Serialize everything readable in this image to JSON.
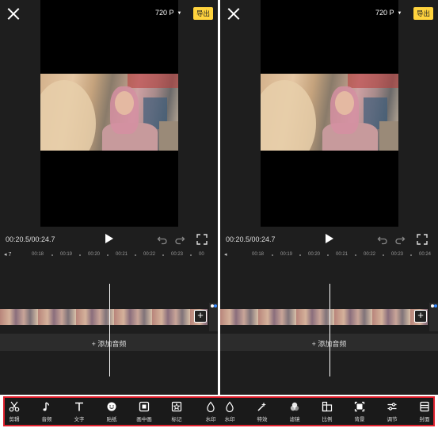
{
  "panes": [
    {
      "resolution": "720 P",
      "export_label": "导出",
      "time": "00:20.5/00:24.7",
      "ruler_start": "7",
      "ticks": [
        "00:18",
        "00:19",
        "00:20",
        "00:21",
        "00:22",
        "00:23",
        "00"
      ],
      "add_audio_label": "+ 添加音频"
    },
    {
      "resolution": "720 P",
      "export_label": "导出",
      "time": "00:20.5/00:24.7",
      "ruler_start": "",
      "ticks": [
        "00:18",
        "00:19",
        "00:20",
        "00:21",
        "00:22",
        "00:23",
        "00:24"
      ],
      "add_audio_label": "+ 添加音频"
    }
  ],
  "toolbar": {
    "items": [
      {
        "label": "剪辑",
        "icon": "scissors-icon"
      },
      {
        "label": "音频",
        "icon": "music-note-icon"
      },
      {
        "label": "文字",
        "icon": "text-icon"
      },
      {
        "label": "贴纸",
        "icon": "sticker-icon"
      },
      {
        "label": "画中画",
        "icon": "picture-in-picture-icon"
      },
      {
        "label": "标记",
        "icon": "mark-icon"
      },
      {
        "label": "水印",
        "icon": "watermark-icon"
      },
      {
        "label": "水印",
        "icon": "watermark-icon"
      },
      {
        "label": "特效",
        "icon": "effects-icon"
      },
      {
        "label": "滤镜",
        "icon": "filter-icon"
      },
      {
        "label": "比例",
        "icon": "ratio-icon"
      },
      {
        "label": "背景",
        "icon": "background-icon"
      },
      {
        "label": "调节",
        "icon": "adjust-icon"
      },
      {
        "label": "封面",
        "icon": "cover-icon"
      }
    ],
    "highlight_color": "#e0202d"
  },
  "colors": {
    "accent": "#ffd33d",
    "panel_bg": "#1e1e1e"
  }
}
